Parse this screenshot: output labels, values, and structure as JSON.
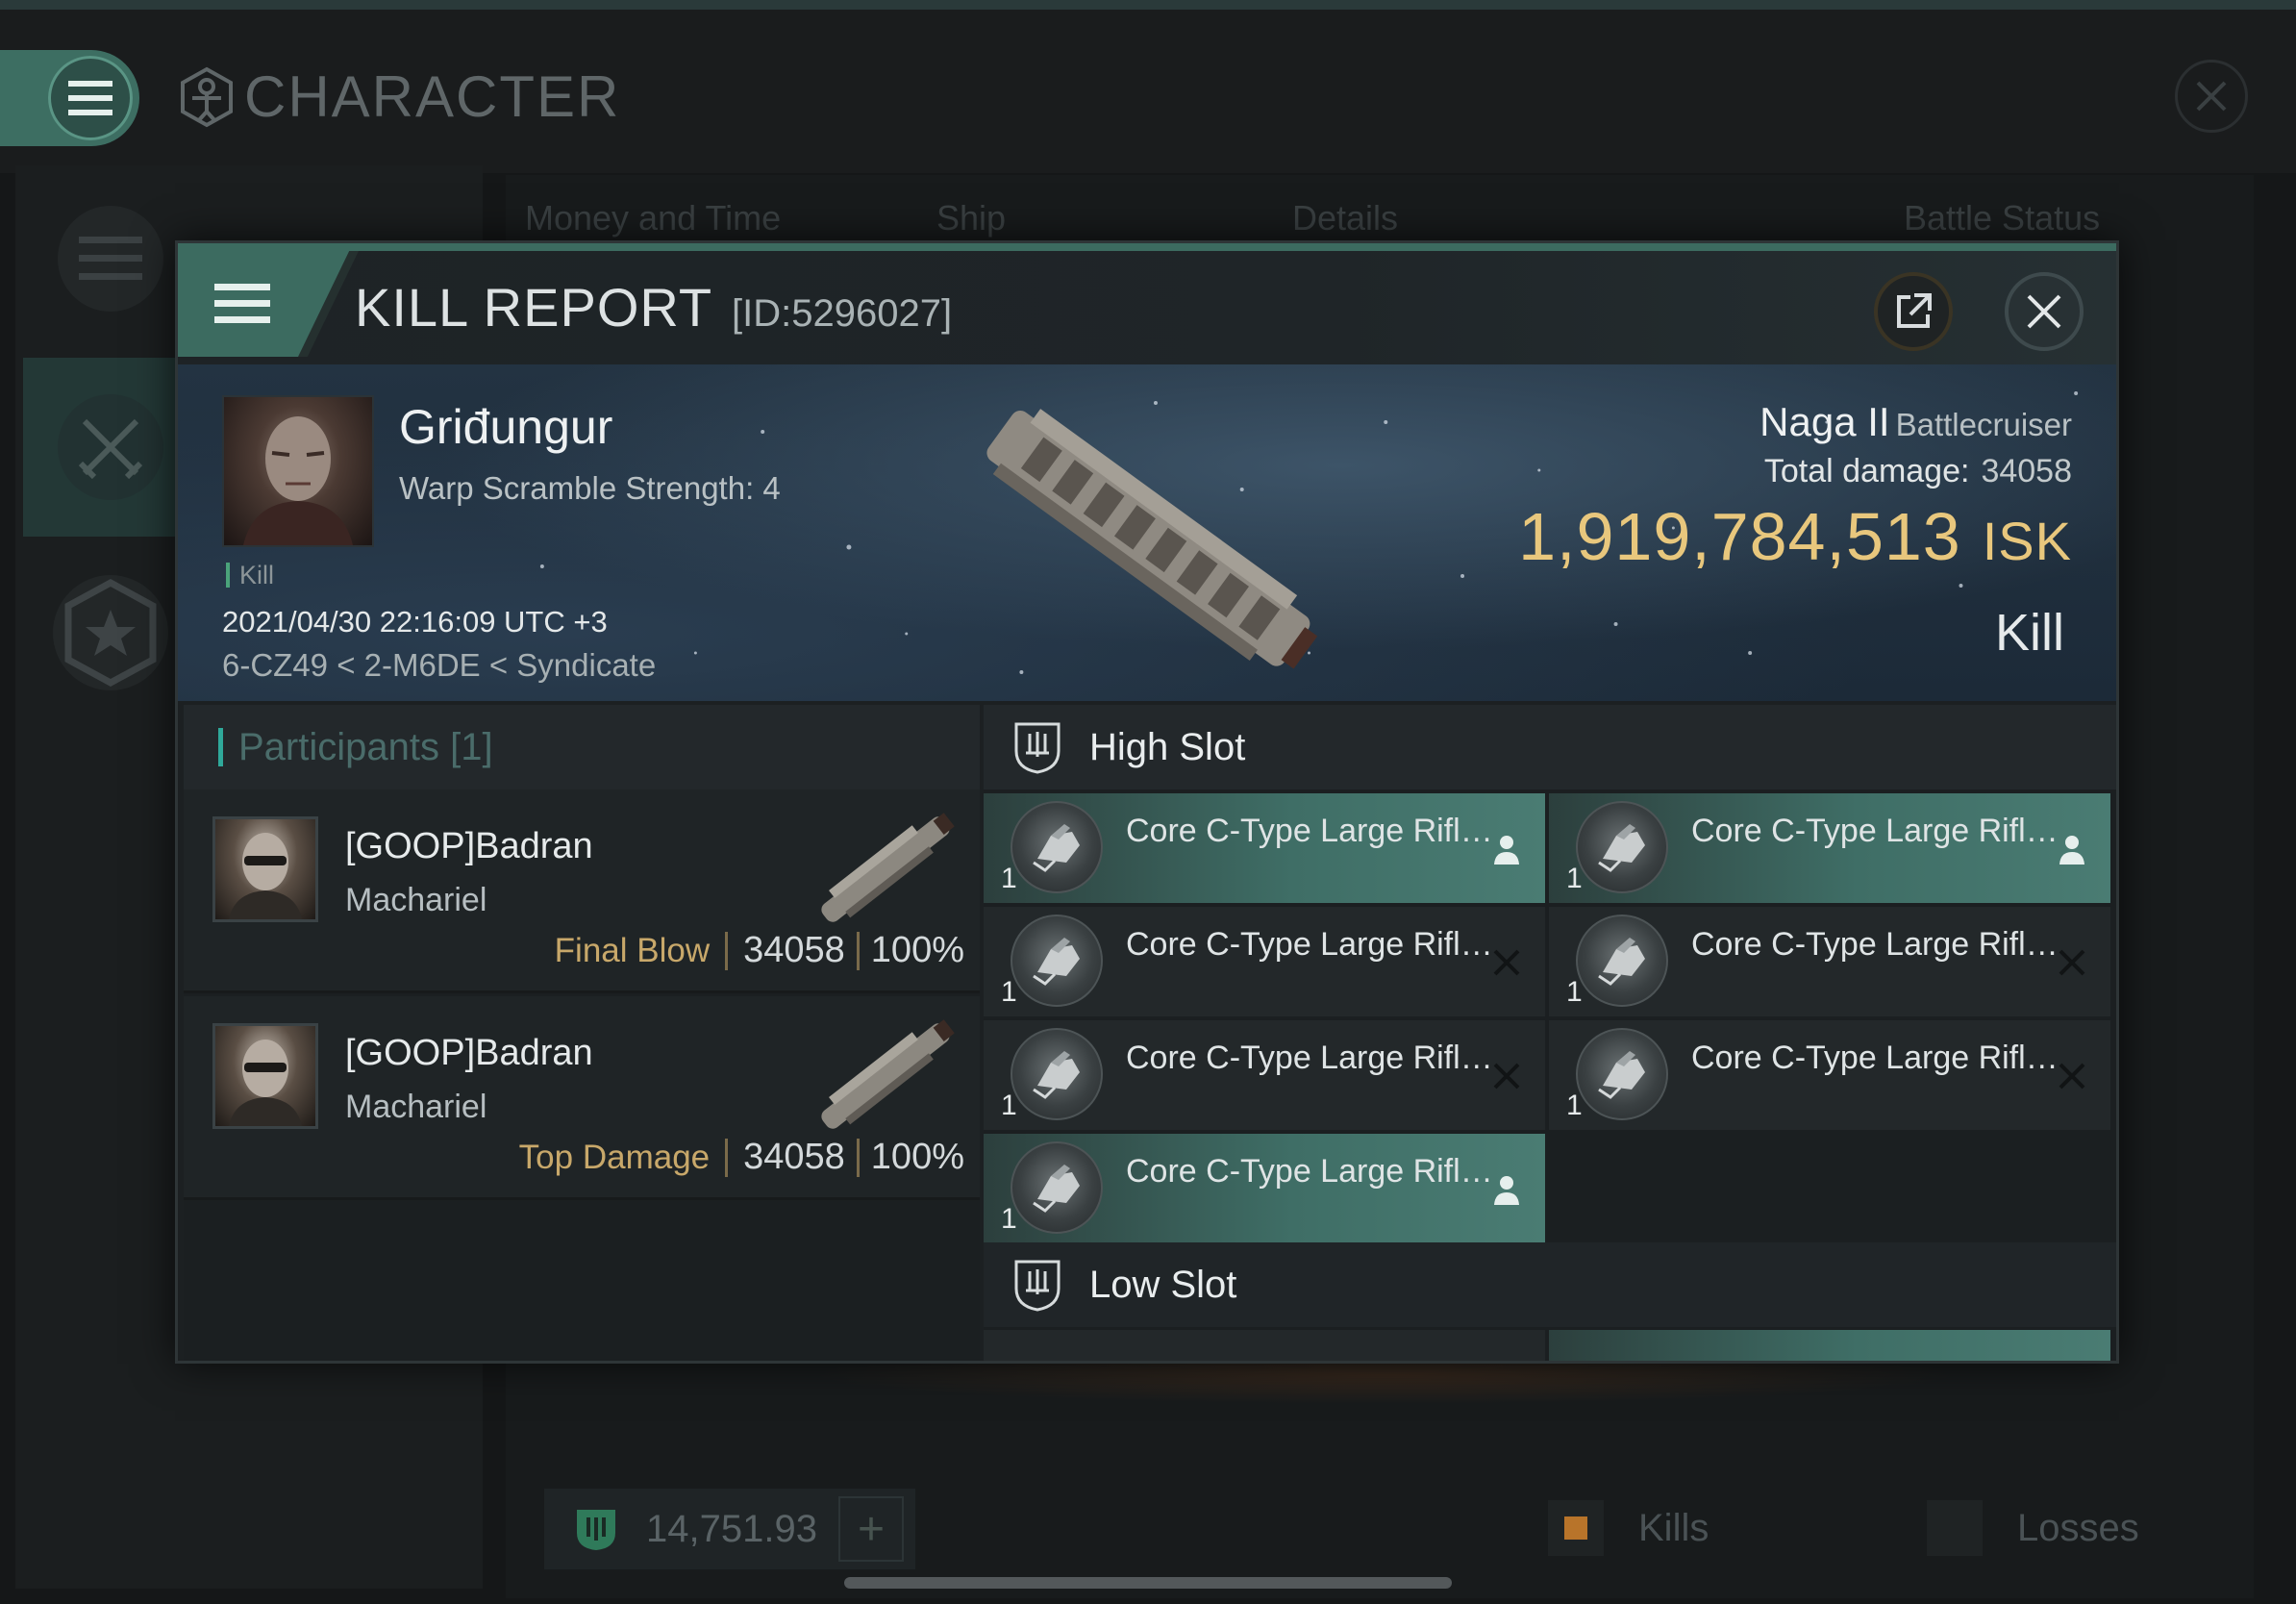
{
  "background": {
    "title": "CHARACTER",
    "tabs": [
      "Money and Time",
      "Ship",
      "Details",
      "Battle Status"
    ],
    "wallet_value": "14,751.93",
    "legend": [
      {
        "label": "Kills",
        "color": "#b8742a"
      },
      {
        "label": "Losses",
        "color": "#2a2e30"
      }
    ]
  },
  "report": {
    "title": "KILL REPORT",
    "id": "[ID:5296027]",
    "victim": {
      "name": "Griđungur",
      "sub": "Warp Scramble Strength: 4",
      "tag": "Kill",
      "time": "2021/04/30 22:16:09 UTC +3",
      "location": "6-CZ49 < 2-M6DE < Syndicate"
    },
    "ship": {
      "name": "Naga II",
      "class": "Battlecruiser",
      "damage_label": "Total damage:",
      "damage_value": "34058",
      "isk_value": "1,919,784,513",
      "isk_unit": "ISK",
      "result": "Kill"
    }
  },
  "participants": {
    "header": "Participants [1]",
    "rows": [
      {
        "name": "[GOOP]Badran",
        "ship": "Machariel",
        "label": "Final Blow",
        "damage": "34058",
        "percent": "100%"
      },
      {
        "name": "[GOOP]Badran",
        "ship": "Machariel",
        "label": "Top Damage",
        "damage": "34058",
        "percent": "100%"
      }
    ]
  },
  "slots": {
    "high_title": "High Slot",
    "low_title": "Low Slot",
    "high_items": [
      {
        "name": "Core C-Type Large Rifled...",
        "qty": "1",
        "status": "dropped"
      },
      {
        "name": "Core C-Type Large Rifled...",
        "qty": "1",
        "status": "dropped"
      },
      {
        "name": "Core C-Type Large Rifled...",
        "qty": "1",
        "status": "destroyed"
      },
      {
        "name": "Core C-Type Large Rifled...",
        "qty": "1",
        "status": "destroyed"
      },
      {
        "name": "Core C-Type Large Rifled...",
        "qty": "1",
        "status": "destroyed"
      },
      {
        "name": "Core C-Type Large Rifled...",
        "qty": "1",
        "status": "destroyed"
      },
      {
        "name": "Core C-Type Large Rifled...",
        "qty": "1",
        "status": "dropped"
      }
    ]
  },
  "colors": {
    "accent": "#3c6b60",
    "isk": "#e8c77d",
    "dropped": "#4a7c73",
    "destroyed": "#23282a"
  }
}
